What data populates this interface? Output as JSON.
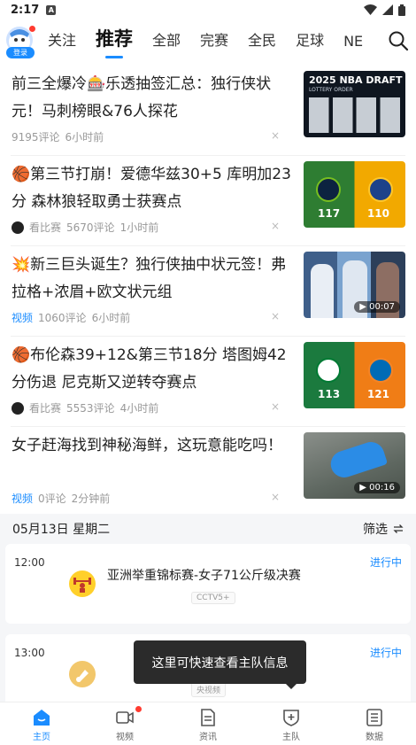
{
  "status_bar": {
    "time": "2:17",
    "notif_letter": "A"
  },
  "header": {
    "login_label": "登录",
    "tabs": [
      {
        "label": "关注"
      },
      {
        "label": "推荐"
      },
      {
        "label": "全部"
      },
      {
        "label": "完赛"
      },
      {
        "label": "全民"
      },
      {
        "label": "足球"
      },
      {
        "label": "NE"
      }
    ]
  },
  "news": [
    {
      "title": "前三全爆冷🎰乐透抽签汇总：独行侠状元！马刺榜眼&76人探花",
      "tag": "",
      "source": "",
      "comments": "9195评论",
      "time": "6小时前",
      "thumb_text": "2025 NBA DRAFT",
      "thumb_sub": "LOTTERY ORDER",
      "duration": ""
    },
    {
      "title": "🏀第三节打崩！爱德华兹30+5 库明加23分 森林狼轻取勇士获赛点",
      "tag": "",
      "source": "看比赛",
      "comments": "5670评论",
      "time": "1小时前",
      "thumb_left": "117",
      "thumb_right": "110",
      "duration": ""
    },
    {
      "title": "💥新三巨头诞生？独行侠抽中状元签！弗拉格+浓眉+欧文状元组",
      "tag": "视频",
      "source": "",
      "comments": "1060评论",
      "time": "6小时前",
      "duration": "07"
    },
    {
      "title": "🏀布伦森39+12&第三节18分 塔图姆42分伤退 尼克斯又逆转夺赛点",
      "tag": "",
      "source": "看比赛",
      "comments": "5553评论",
      "time": "4小时前",
      "thumb_left": "113",
      "thumb_right": "121",
      "duration": ""
    },
    {
      "title": "女子赶海找到神秘海鲜，这玩意能吃吗！",
      "tag": "视频",
      "source": "",
      "comments": "0评论",
      "time": "2分钟前",
      "duration": "16"
    }
  ],
  "close_glyph": "×",
  "date_bar": {
    "date": "05月13日 星期二",
    "filter_label": "筛选"
  },
  "matches": [
    {
      "time": "12:00",
      "title": "亚洲举重锦标赛-女子71公斤级决赛",
      "channel": "CCTV5+",
      "status": "进行中"
    },
    {
      "time": "13:00",
      "title": "",
      "channel": "央视频",
      "status": "进行中"
    }
  ],
  "tooltip": "这里可快速查看主队信息",
  "bottom_nav": [
    {
      "label": "主页"
    },
    {
      "label": "视频"
    },
    {
      "label": "资讯"
    },
    {
      "label": "主队"
    },
    {
      "label": "数据"
    }
  ],
  "colors": {
    "accent": "#1a8cff",
    "badge": "#ff3b30"
  }
}
